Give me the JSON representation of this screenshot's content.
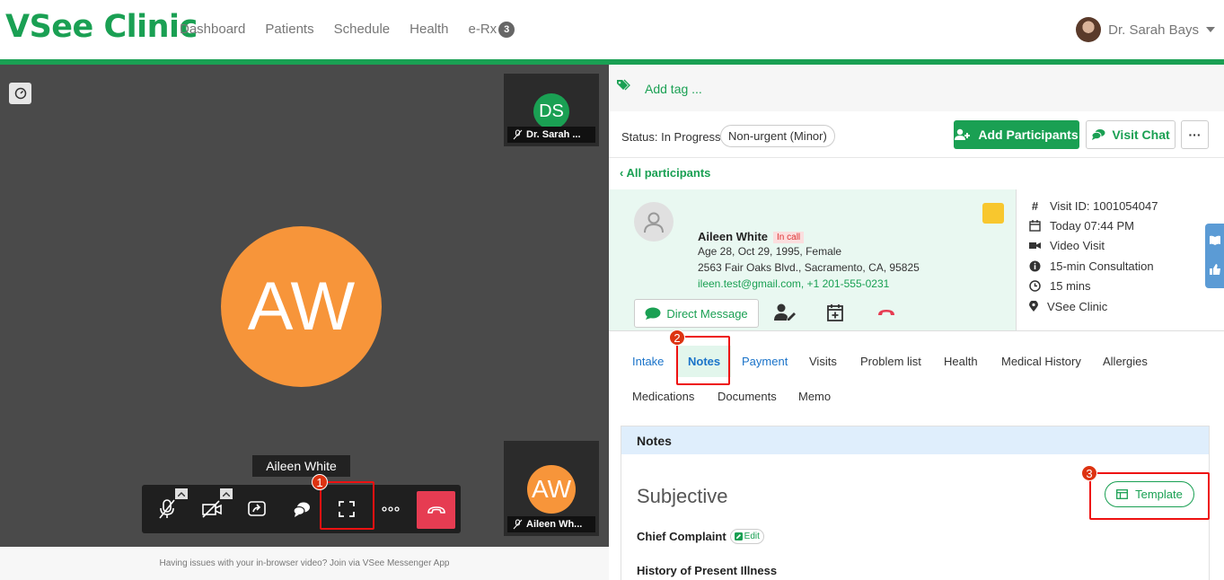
{
  "app": {
    "logo": "VSee Clinic"
  },
  "nav": {
    "items": [
      "Dashboard",
      "Patients",
      "Schedule",
      "Health"
    ],
    "erx_label": "e-Rx",
    "erx_badge": "3"
  },
  "user": {
    "name": "Dr. Sarah Bays"
  },
  "video": {
    "main_initials": "AW",
    "thumb_top": {
      "initials": "DS",
      "label": "Dr. Sarah ..."
    },
    "thumb_bottom": {
      "initials": "AW",
      "label": "Aileen Wh..."
    },
    "name_tooltip": "Aileen White",
    "footer_note": "Having issues with your in-browser video? Join via VSee Messenger App"
  },
  "steps": {
    "one": "1",
    "two": "2",
    "three": "3"
  },
  "panel": {
    "add_tag": "Add tag ...",
    "status_text": "Status: In Progress",
    "urgency": "Non-urgent (Minor)",
    "add_participants": "Add Participants",
    "visit_chat": "Visit Chat",
    "more": "···",
    "all_participants": "All participants"
  },
  "patient": {
    "name": "Aileen White",
    "in_call": "In call",
    "age_line": "Age 28, Oct 29, 1995, Female",
    "address": "2563 Fair Oaks Blvd., Sacramento, CA, 95825",
    "contact": "ileen.test@gmail.com, +1 201-555-0231",
    "direct_message": "Direct Message"
  },
  "visit": {
    "id": "Visit ID: 1001054047",
    "time": "Today 07:44 PM",
    "type": "Video Visit",
    "consult": "15-min Consultation",
    "duration": "15 mins",
    "clinic": "VSee Clinic"
  },
  "tabs": {
    "intake": "Intake",
    "notes": "Notes",
    "payment": "Payment",
    "visits": "Visits",
    "problem_list": "Problem list",
    "health": "Health",
    "medical_history": "Medical History",
    "allergies": "Allergies",
    "medications": "Medications",
    "documents": "Documents",
    "memo": "Memo"
  },
  "notes": {
    "header": "Notes",
    "subjective": "Subjective",
    "template": "Template",
    "chief_complaint": "Chief Complaint",
    "edit": "Edit",
    "hpi": "History of Present Illness"
  },
  "colors": {
    "brand_green": "#1aa053",
    "avatar_orange": "#f7953a",
    "hangup_red": "#e63c52",
    "highlight_red": "#e11"
  }
}
